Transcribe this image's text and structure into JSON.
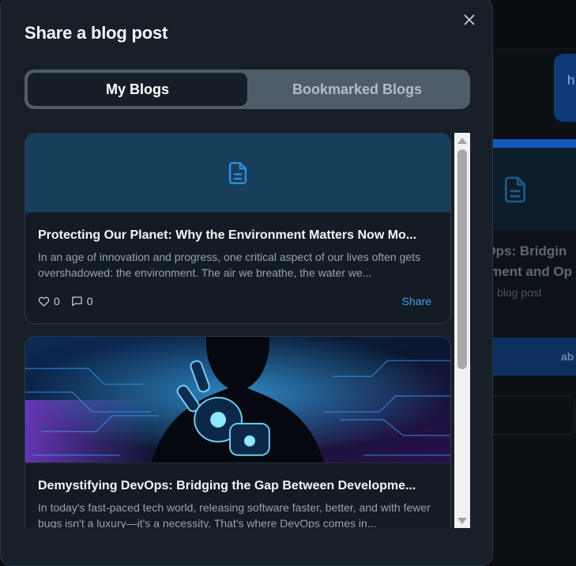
{
  "background": {
    "chip_text": "h",
    "card_title": "vOps: Bridgin\nloment and Op",
    "card_subtitle": "blog post",
    "card_button": "ab"
  },
  "modal": {
    "title": "Share a blog post",
    "close_label": "×"
  },
  "tabs": [
    {
      "label": "My Blogs",
      "active": true
    },
    {
      "label": "Bookmarked Blogs",
      "active": false
    }
  ],
  "posts": [
    {
      "title": "Protecting Our Planet: Why the Environment Matters Now Mo...",
      "excerpt": "In an age of innovation and progress, one critical aspect of our lives often gets overshadowed: the environment. The air we breathe, the water we...",
      "likes": "0",
      "comments": "0",
      "share_label": "Share",
      "media": "document-icon"
    },
    {
      "title": "Demystifying DevOps: Bridging the Gap Between Developme...",
      "excerpt": "In today's fast-paced tech world, releasing software faster, better, and with fewer bugs isn't a luxury—it's a necessity. That's where DevOps comes in...",
      "media": "cyber-robot-hand-image"
    }
  ],
  "colors": {
    "accent": "#3fa2f0",
    "modal_bg": "#171f28",
    "card_bg": "#131b24"
  }
}
